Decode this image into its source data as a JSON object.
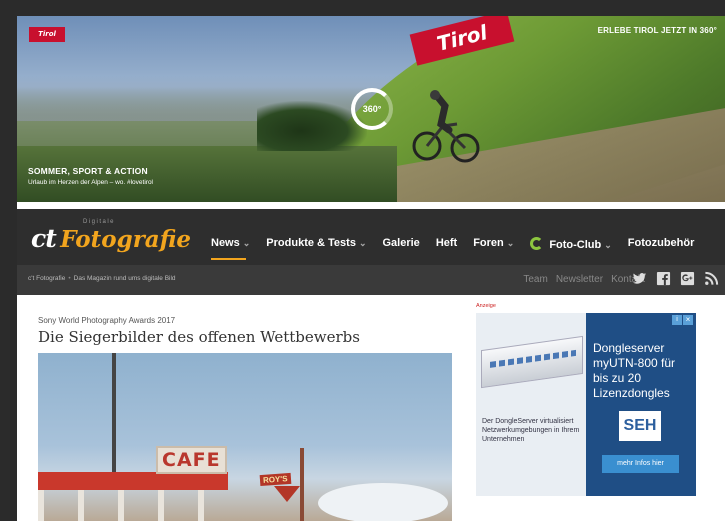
{
  "banner": {
    "logo_text": "Tirol",
    "flag_text": "Tirol",
    "cta": "ERLEBE TIROL JETZT IN 360°",
    "vr_label": "360°",
    "headline": "SOMMER, SPORT & ACTION",
    "subline": "Urlaub im Herzen der Alpen – wo. #lovetirol"
  },
  "site": {
    "logo_ct": "ct",
    "logo_foto": "Fotografie",
    "logo_digitale": "Digitale"
  },
  "nav": {
    "items": [
      {
        "label": "News",
        "caret": "⌄"
      },
      {
        "label": "Produkte & Tests",
        "caret": "⌄"
      },
      {
        "label": "Galerie",
        "caret": ""
      },
      {
        "label": "Heft",
        "caret": ""
      },
      {
        "label": "Foren",
        "caret": "⌄"
      },
      {
        "label": "Foto-Club",
        "caret": "⌄"
      },
      {
        "label": "Fotozubehör",
        "caret": ""
      }
    ]
  },
  "subbar": {
    "breadcrumb_home": "c't Fotografie",
    "breadcrumb_sep": "•",
    "breadcrumb_tagline": "Das Magazin rund ums digitale Bild",
    "links": [
      "Team",
      "Newsletter",
      "Kontakt"
    ],
    "social_icons": [
      "twitter-icon",
      "facebook-icon",
      "google-plus-icon",
      "rss-icon"
    ]
  },
  "article": {
    "kicker": "Sony World Photography Awards 2017",
    "title": "Die Siegerbilder des offenen Wettbewerbs",
    "image_cafe_sign": "CAFE",
    "image_roys_sign": "ROY'S"
  },
  "ad": {
    "label": "Anzeige",
    "close": "×",
    "adinfo": "i",
    "headline": "Dongleserver myUTN-800 für bis zu 20 Lizenzdongles",
    "left_text": "Der DongleServer virtualisiert Netzwerkumgebungen in Ihrem Unternehmen",
    "brand": "SEH",
    "button": "mehr Infos hier"
  }
}
